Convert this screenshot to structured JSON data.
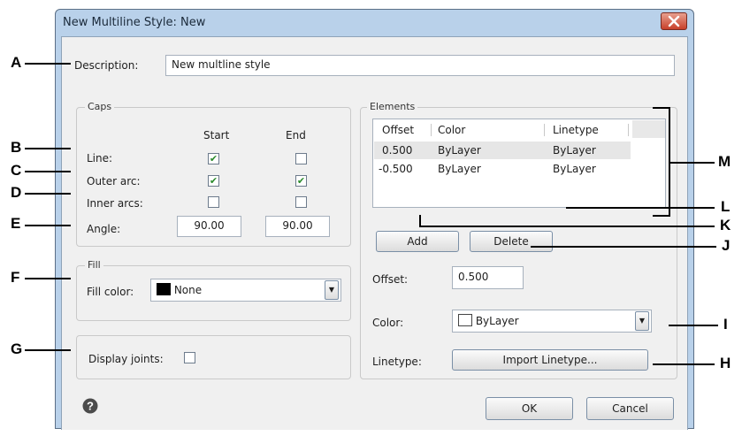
{
  "dialog": {
    "title": "New Multiline Style: New"
  },
  "description": {
    "label": "Description:",
    "value": "New multline style"
  },
  "caps": {
    "group_label": "Caps",
    "col_start": "Start",
    "col_end": "End",
    "rows": [
      {
        "label": "Line:",
        "start": true,
        "end": false
      },
      {
        "label": "Outer arc:",
        "start": true,
        "end": true
      },
      {
        "label": "Inner arcs:",
        "start": false,
        "end": false
      }
    ],
    "angle": {
      "label": "Angle:",
      "start": "90.00",
      "end": "90.00"
    }
  },
  "fill": {
    "group_label": "Fill",
    "label": "Fill color:",
    "value": "None",
    "swatch_color": "#000000"
  },
  "joints": {
    "label": "Display joints:",
    "checked": false
  },
  "elements": {
    "group_label": "Elements",
    "columns": [
      "Offset",
      "Color",
      "Linetype"
    ],
    "rows": [
      {
        "offset": "0.500",
        "color": "ByLayer",
        "linetype": "ByLayer",
        "selected": true
      },
      {
        "offset": "-0.500",
        "color": "ByLayer",
        "linetype": "ByLayer",
        "selected": false
      }
    ],
    "add_label": "Add",
    "delete_label": "Delete",
    "offset_label": "Offset:",
    "offset_value": "0.500",
    "color_label": "Color:",
    "color_value": "ByLayer",
    "color_swatch": "#ffffff",
    "linetype_label": "Linetype:",
    "linetype_button": "Import Linetype..."
  },
  "footer": {
    "help_icon": "question-circle-icon",
    "ok_label": "OK",
    "cancel_label": "Cancel"
  },
  "callouts": {
    "A": "A",
    "B": "B",
    "C": "C",
    "D": "D",
    "E": "E",
    "F": "F",
    "G": "G",
    "H": "H",
    "I": "I",
    "J": "J",
    "K": "K",
    "L": "L",
    "M": "M"
  },
  "colors": {
    "title_bar": "#b9d1ea",
    "client": "#f0f0f0",
    "selection": "#e6e6e6",
    "close_button": "#c8402a"
  }
}
